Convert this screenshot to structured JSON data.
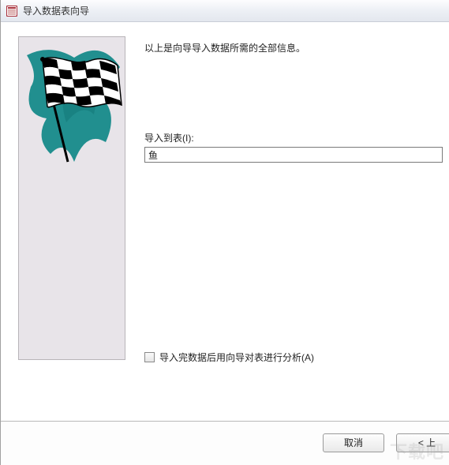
{
  "window": {
    "title": "导入数据表向导"
  },
  "intro": "以上是向导导入数据所需的全部信息。",
  "import_to": {
    "label": "导入到表(I):",
    "value": "鱼"
  },
  "analyze": {
    "label": "导入完数据后用向导对表进行分析(A)",
    "checked": false
  },
  "buttons": {
    "cancel": "取消",
    "back": "< 上"
  },
  "watermark": "下载吧",
  "icons": {
    "app": "access-icon",
    "wizard_image": "checkered-flag"
  }
}
